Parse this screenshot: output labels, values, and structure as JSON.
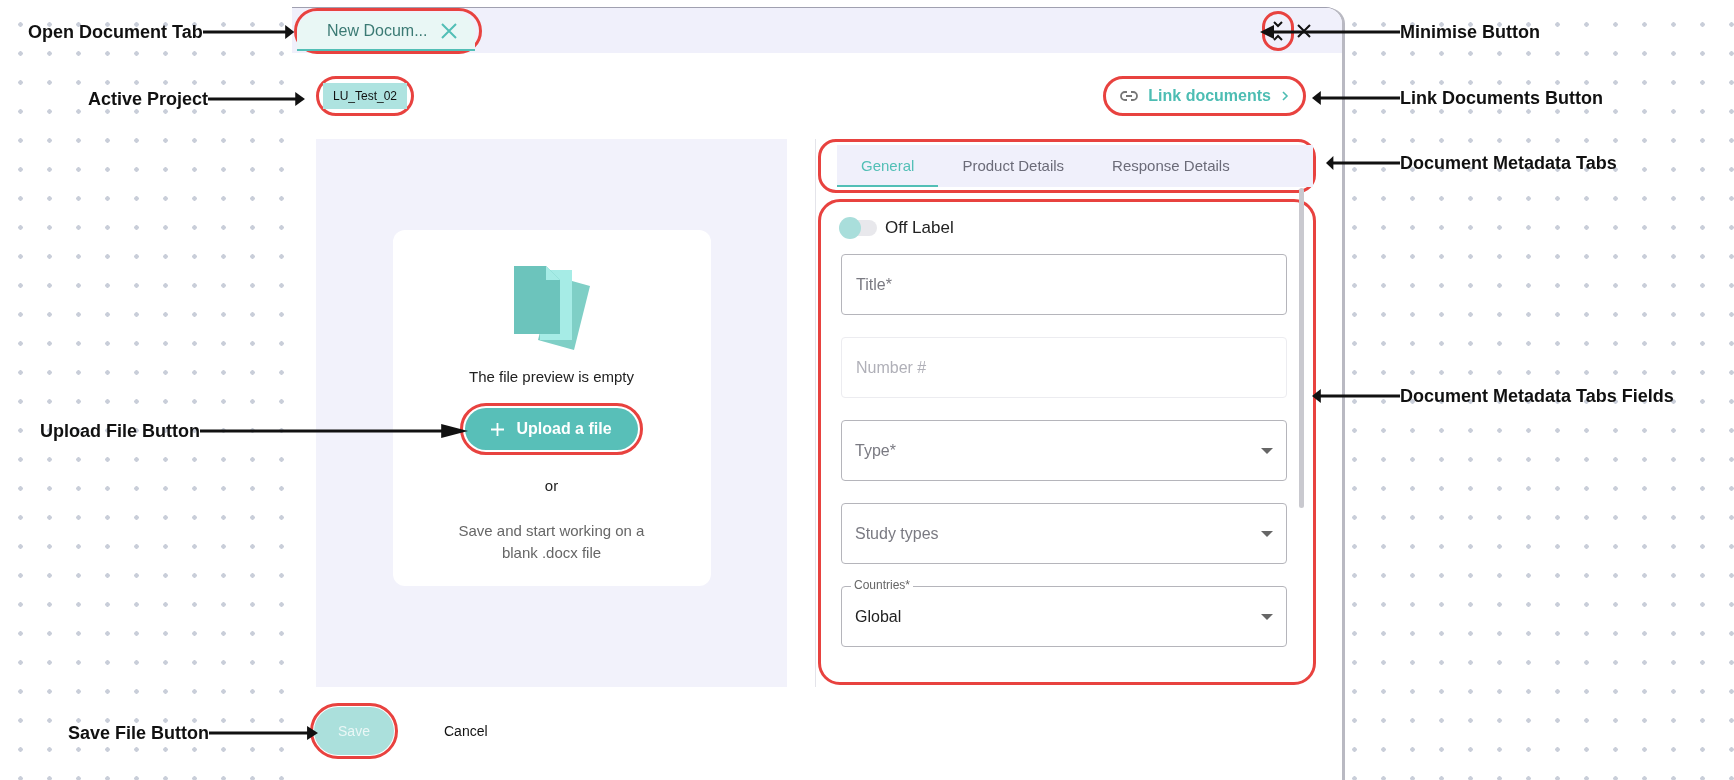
{
  "annotations_left": [
    {
      "label": "Open Document Tab"
    },
    {
      "label": "Active Project"
    },
    {
      "label": "Upload File Button"
    },
    {
      "label": "Save File Button"
    }
  ],
  "annotations_right": [
    {
      "label": "Minimise Button"
    },
    {
      "label": "Link Documents Button"
    },
    {
      "label": "Document Metadata Tabs"
    },
    {
      "label": "Document Metadata Tabs Fields"
    }
  ],
  "document_tab": {
    "label": "New Docum...",
    "selected": true
  },
  "project": "LU_Test_02",
  "link_button": "Link documents",
  "preview": {
    "message": "The file preview is empty",
    "upload_button": "Upload a file",
    "separator": "or",
    "hint": "Save and start working on a blank .docx file"
  },
  "metadata_tabs": [
    {
      "label": "General",
      "selected": true
    },
    {
      "label": "Product Details",
      "selected": false
    },
    {
      "label": "Response Details",
      "selected": false
    }
  ],
  "toggle": {
    "label": "Off Label",
    "on": false
  },
  "fields": [
    {
      "kind": "text",
      "placeholder": "Title*",
      "disabled": false
    },
    {
      "kind": "text",
      "placeholder": "Number #",
      "disabled": true
    },
    {
      "kind": "select",
      "placeholder": "Type*"
    },
    {
      "kind": "select",
      "placeholder": "Study types"
    },
    {
      "kind": "select",
      "label": "Countries*",
      "value": "Global"
    }
  ],
  "footer": {
    "save": {
      "label": "Save",
      "disabled": true
    },
    "cancel": "Cancel"
  }
}
